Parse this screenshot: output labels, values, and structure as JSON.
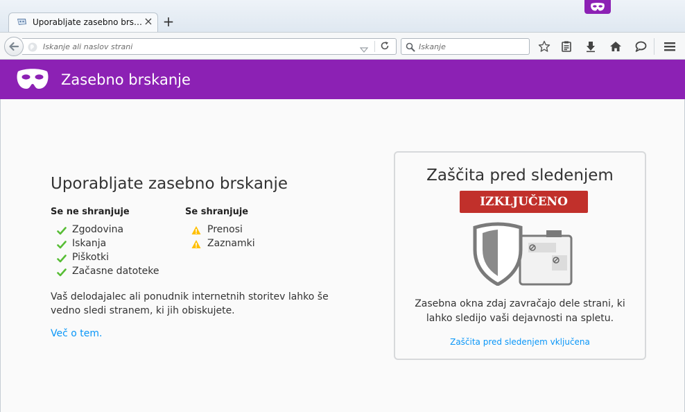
{
  "browser": {
    "tab": {
      "title": "Uporabljate zasebno brskanje"
    },
    "url_placeholder": "Iskanje ali naslov strani",
    "search_placeholder": "Iskanje"
  },
  "header": {
    "title": "Zasebno brskanje"
  },
  "main": {
    "title": "Uporabljate zasebno brskanje",
    "not_saved_heading": "Se ne shranjuje",
    "not_saved_items": [
      "Zgodovina",
      "Iskanja",
      "Piškotki",
      "Začasne datoteke"
    ],
    "saved_heading": "Se shranjuje",
    "saved_items": [
      "Prenosi",
      "Zaznamki"
    ],
    "paragraph": "Vaš delodajalec ali ponudnik internetnih storitev lahko še vedno sledi stranem, ki jih obiskujete.",
    "learn_more": "Več o tem."
  },
  "tracking": {
    "title": "Zaščita pred sledenjem",
    "status": "IZKLJUČENO",
    "description": "Zasebna okna zdaj zavračajo dele strani, ki lahko sledijo vaši dejavnosti na spletu.",
    "link": "Zaščita pred sledenjem vključena"
  },
  "colors": {
    "accent": "#8c21b4",
    "link": "#0996f8",
    "status_off": "#c1302b",
    "check": "#57bd35",
    "warn": "#ffbf00"
  }
}
